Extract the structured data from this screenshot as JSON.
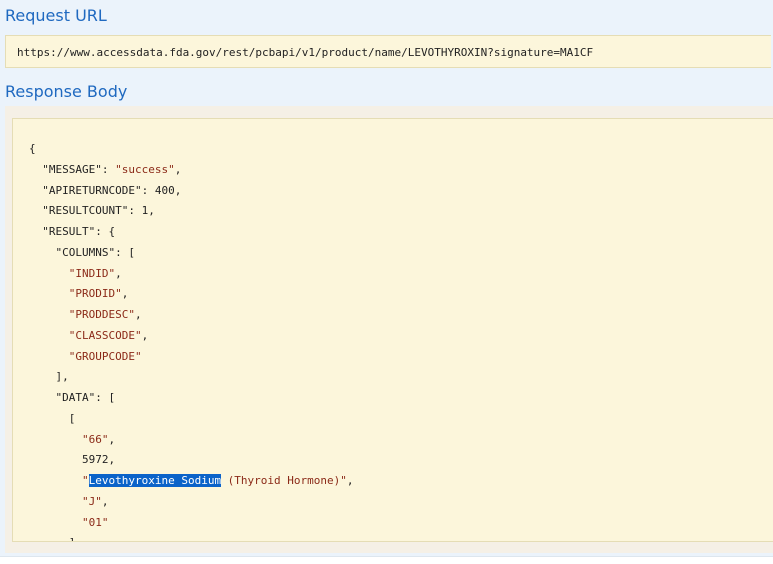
{
  "request": {
    "title": "Request URL",
    "url": "https://www.accessdata.fda.gov/rest/pcbapi/v1/product/name/LEVOTHYROXIN?signature=MA1CF"
  },
  "response": {
    "title": "Response Body",
    "lines": {
      "l1": "{",
      "l2_key": "\"MESSAGE\"",
      "l2_val": "\"success\"",
      "l3_key": "\"APIRETURNCODE\"",
      "l3_val": "400",
      "l4_key": "\"RESULTCOUNT\"",
      "l4_val": "1",
      "l5_key": "\"RESULT\"",
      "l6_key": "\"COLUMNS\"",
      "col1": "\"INDID\"",
      "col2": "\"PRODID\"",
      "col3": "\"PRODDESC\"",
      "col4": "\"CLASSCODE\"",
      "col5": "\"GROUPCODE\"",
      "l12": "],",
      "l13_key": "\"DATA\"",
      "l14": "[",
      "d1": "\"66\"",
      "d2": "5972",
      "d3_selected": "Levothyroxine Sodium",
      "d3_rest": " (Thyroid Hormone)\"",
      "d4": "\"J\"",
      "d5": "\"01\"",
      "l21": "]"
    }
  }
}
